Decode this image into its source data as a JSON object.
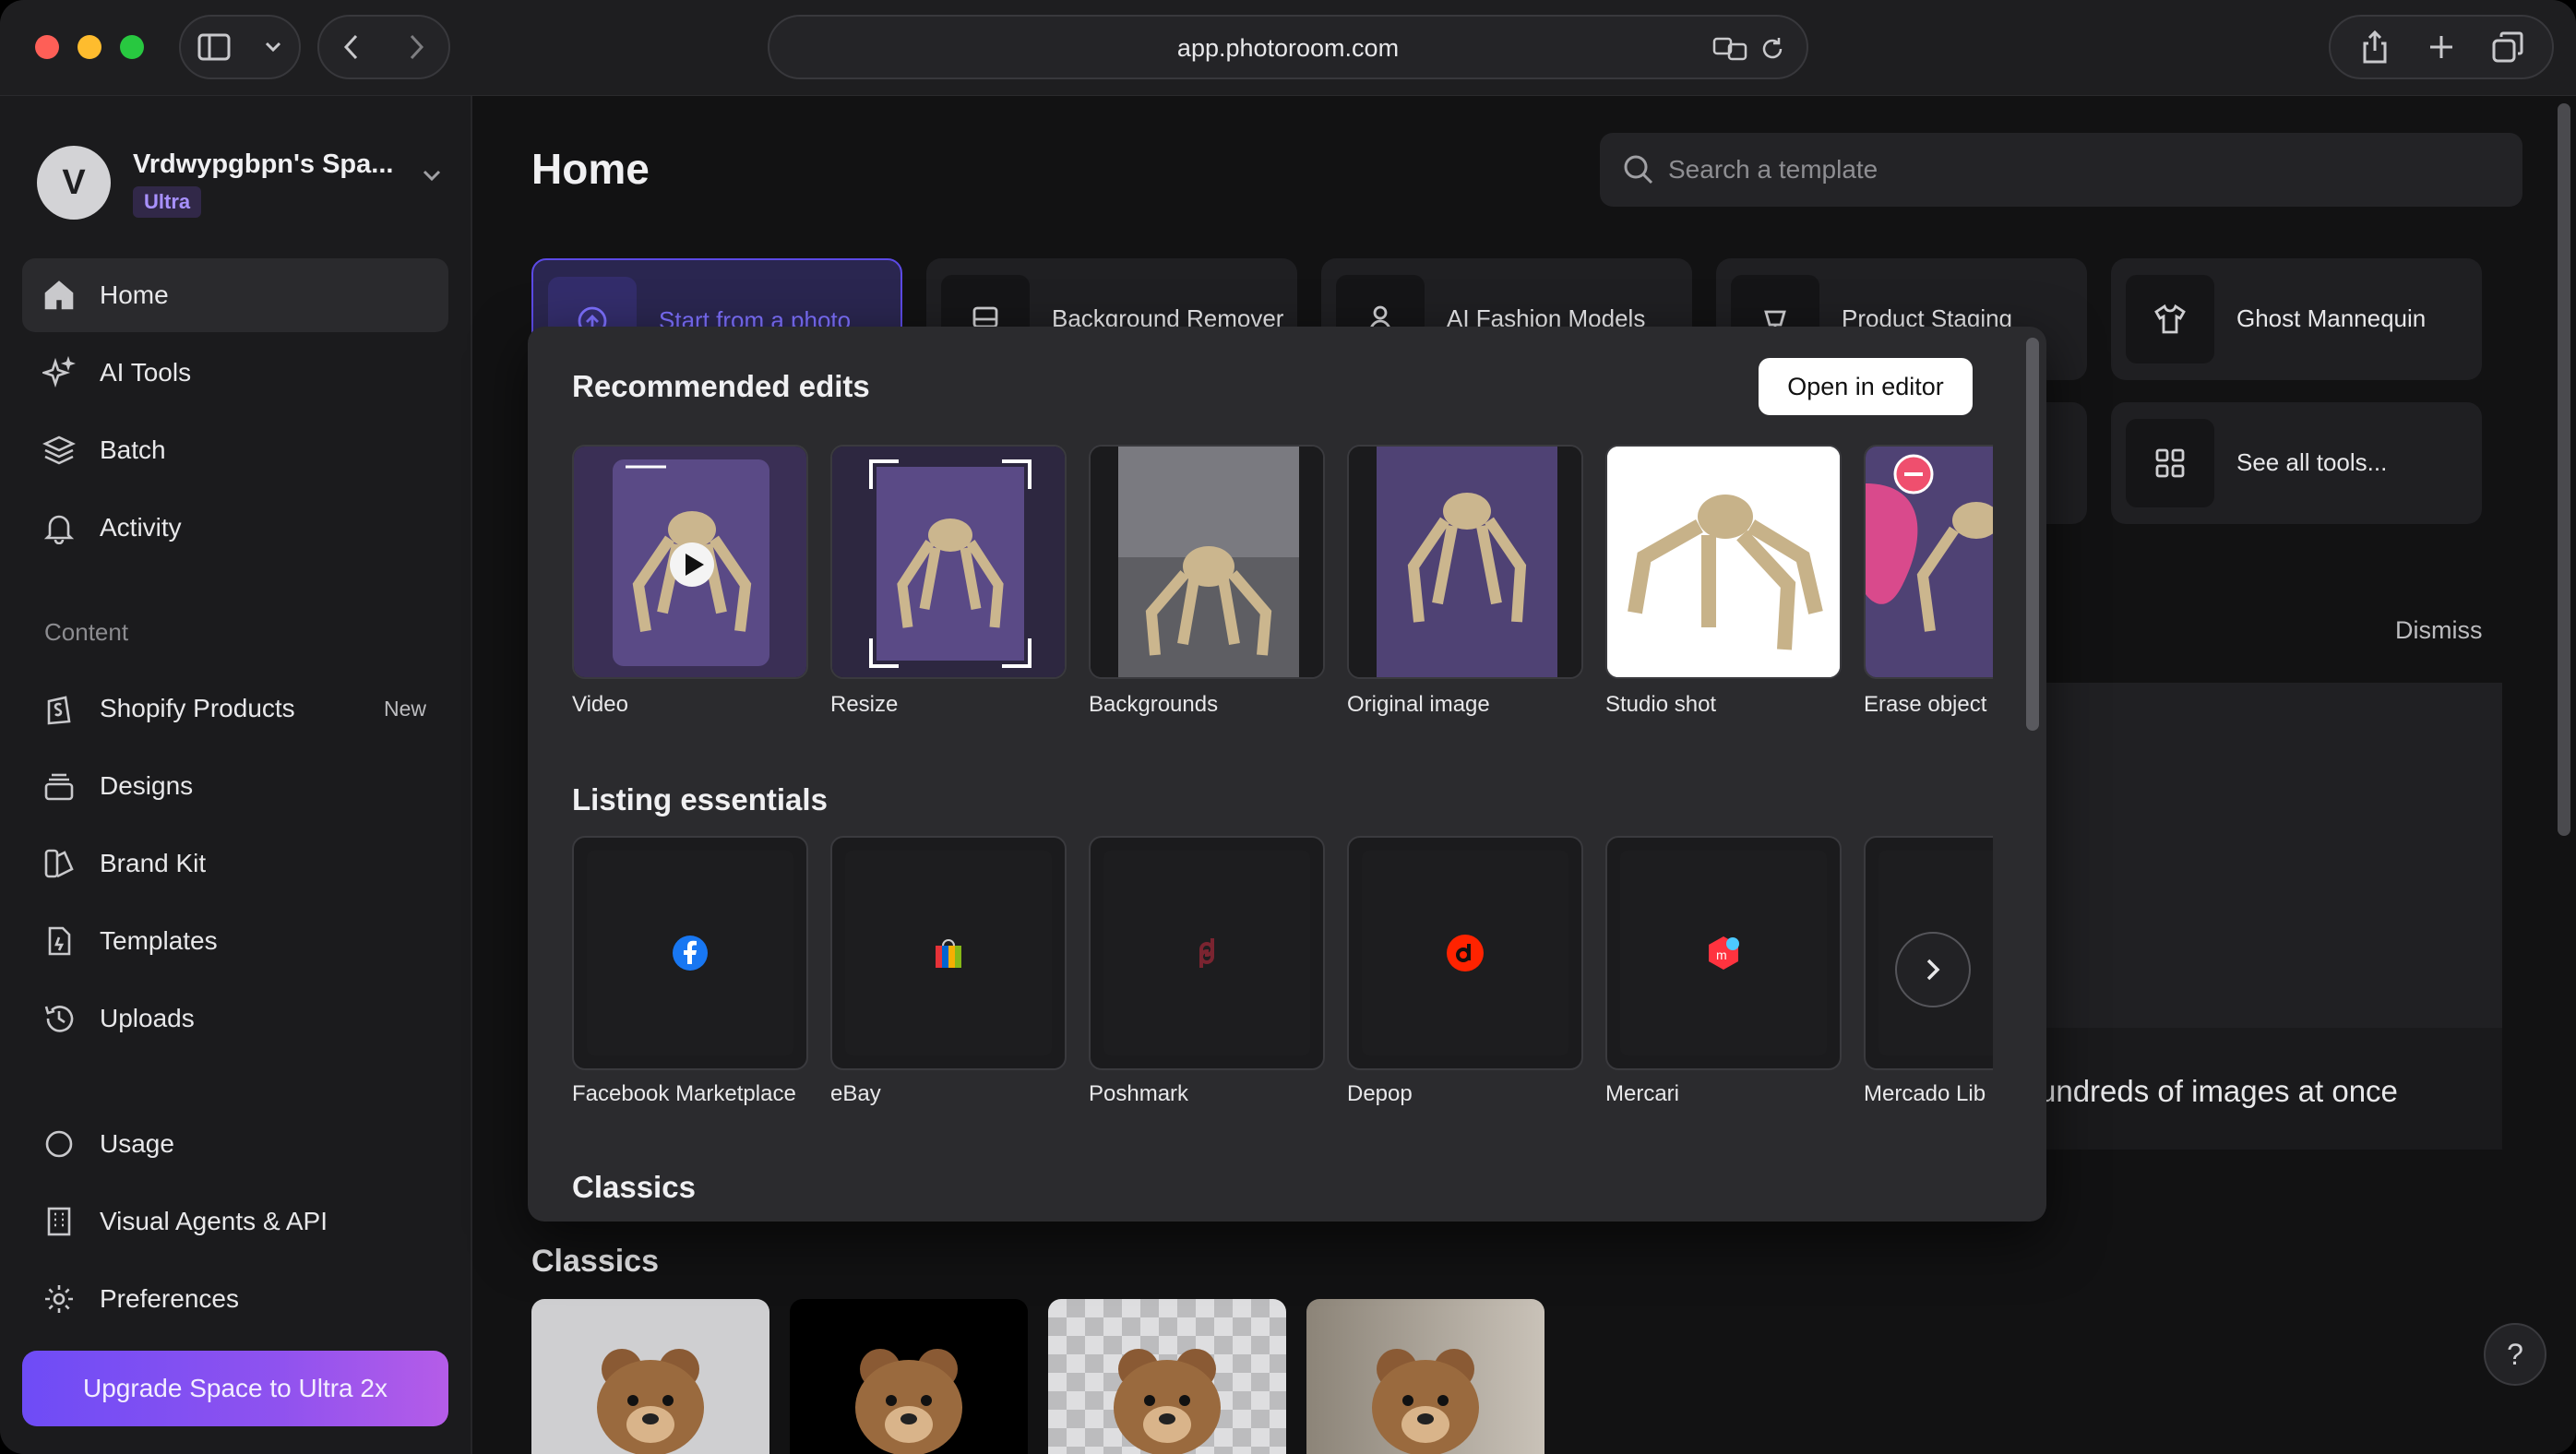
{
  "browser": {
    "url": "app.photoroom.com"
  },
  "sidebar": {
    "space_initial": "V",
    "space_name": "Vrdwypgbpn's Spa...",
    "plan": "Ultra",
    "nav_primary": [
      {
        "label": "Home",
        "icon": "home-icon",
        "active": true
      },
      {
        "label": "AI Tools",
        "icon": "sparkles-icon"
      },
      {
        "label": "Batch",
        "icon": "layers-icon"
      },
      {
        "label": "Activity",
        "icon": "bell-icon"
      }
    ],
    "content_label": "Content",
    "nav_content": [
      {
        "label": "Shopify Products",
        "icon": "shopify-icon",
        "badge": "New"
      },
      {
        "label": "Designs",
        "icon": "stack-icon"
      },
      {
        "label": "Brand Kit",
        "icon": "brand-kit-icon"
      },
      {
        "label": "Templates",
        "icon": "template-icon"
      },
      {
        "label": "Uploads",
        "icon": "history-icon"
      }
    ],
    "nav_bottom": [
      {
        "label": "Usage",
        "icon": "circle-icon"
      },
      {
        "label": "Visual Agents & API",
        "icon": "building-icon"
      },
      {
        "label": "Preferences",
        "icon": "gear-icon"
      }
    ],
    "upgrade_label": "Upgrade Space to Ultra 2x"
  },
  "main": {
    "title": "Home",
    "search_placeholder": "Search a template",
    "tools_row1": [
      {
        "label": "Start from a photo",
        "icon": "upload-icon"
      },
      {
        "label": "Background Remover",
        "icon": "eraser-icon"
      },
      {
        "label": "AI Fashion Models",
        "icon": "person-icon"
      },
      {
        "label": "Product Staging",
        "icon": "lamp-icon"
      },
      {
        "label": "Ghost Mannequin",
        "icon": "shirt-icon"
      }
    ],
    "see_all": "See all tools...",
    "dismiss": "Dismiss",
    "banner_text": "undreds of images at once",
    "classics_title": "Classics",
    "help": "?"
  },
  "popover": {
    "recommended_title": "Recommended edits",
    "open_editor": "Open in editor",
    "recommended": [
      {
        "label": "Video"
      },
      {
        "label": "Resize"
      },
      {
        "label": "Backgrounds"
      },
      {
        "label": "Original image"
      },
      {
        "label": "Studio shot"
      },
      {
        "label": "Erase object"
      }
    ],
    "listing_title": "Listing essentials",
    "listing": [
      {
        "label": "Facebook Marketplace",
        "icon": "facebook-icon"
      },
      {
        "label": "eBay",
        "icon": "ebay-bag-icon"
      },
      {
        "label": "Poshmark",
        "icon": "poshmark-icon"
      },
      {
        "label": "Depop",
        "icon": "depop-icon"
      },
      {
        "label": "Mercari",
        "icon": "mercari-icon"
      },
      {
        "label": "Mercado Lib",
        "icon": "mercado-libre-icon"
      }
    ],
    "classics_title": "Classics"
  },
  "colors": {
    "accent": "#6e4cf6",
    "plan_badge": "#a891ff",
    "background": "#121213"
  }
}
